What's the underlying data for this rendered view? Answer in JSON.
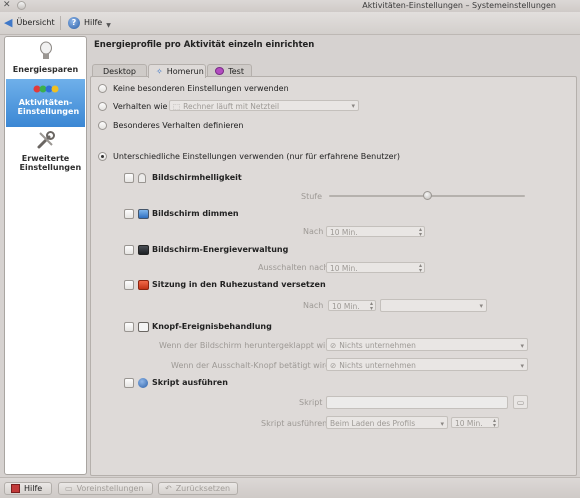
{
  "window": {
    "title": "Aktivitäten-Einstellungen – Systemeinstellungen"
  },
  "toolbar": {
    "overview_label": "Übersicht",
    "help_label": "Hilfe"
  },
  "sidebar": {
    "items": [
      {
        "label": "Energiesparen",
        "icon": "lightbulb-icon"
      },
      {
        "label": "Aktivitäten-Einstellungen",
        "icon": "activities-icon"
      },
      {
        "label": "Erweiterte Einstellungen",
        "icon": "tools-icon"
      }
    ]
  },
  "main": {
    "heading": "Energieprofile pro Aktivität einzeln einrichten",
    "tabs": [
      {
        "label": "Desktop"
      },
      {
        "label": "Homerun"
      },
      {
        "label": "Test"
      }
    ],
    "options": {
      "no_special": "Keine besonderen Einstellungen verwenden",
      "behave_like": "Verhalten wie",
      "behave_like_value": "Rechner läuft mit Netzteil",
      "special_behavior": "Besonderes Verhalten definieren",
      "separate": "Unterschiedliche Einstellungen verwenden (nur für erfahrene Benutzer)"
    },
    "sections": {
      "brightness": {
        "label": "Bildschirmhelligkeit",
        "level_label": "Stufe",
        "level_value": 0.5
      },
      "dim": {
        "label": "Bildschirm dimmen",
        "after_label": "Nach",
        "after_value": "10 Min."
      },
      "energy": {
        "label": "Bildschirm-Energieverwaltung",
        "off_after_label": "Ausschalten nach",
        "off_after_value": "10 Min."
      },
      "suspend": {
        "label": "Sitzung in den Ruhezustand versetzen",
        "after_label": "Nach",
        "after_value": "10 Min.",
        "mode_value": ""
      },
      "button_events": {
        "label": "Knopf-Ereignisbehandlung",
        "lid_label": "Wenn der Bildschirm heruntergeklappt wird",
        "lid_value": "Nichts unternehmen",
        "power_label": "Wenn der Ausschalt-Knopf betätigt wird",
        "power_value": "Nichts unternehmen"
      },
      "script": {
        "label": "Skript ausführen",
        "script_label": "Skript",
        "script_value": "",
        "run_label": "Skript ausführen",
        "run_value": "Beim Laden des Profils",
        "run_after_value": "10 Min."
      }
    }
  },
  "bottombar": {
    "help_label": "Hilfe",
    "defaults_label": "Voreinstellungen",
    "reset_label": "Zurücksetzen"
  }
}
